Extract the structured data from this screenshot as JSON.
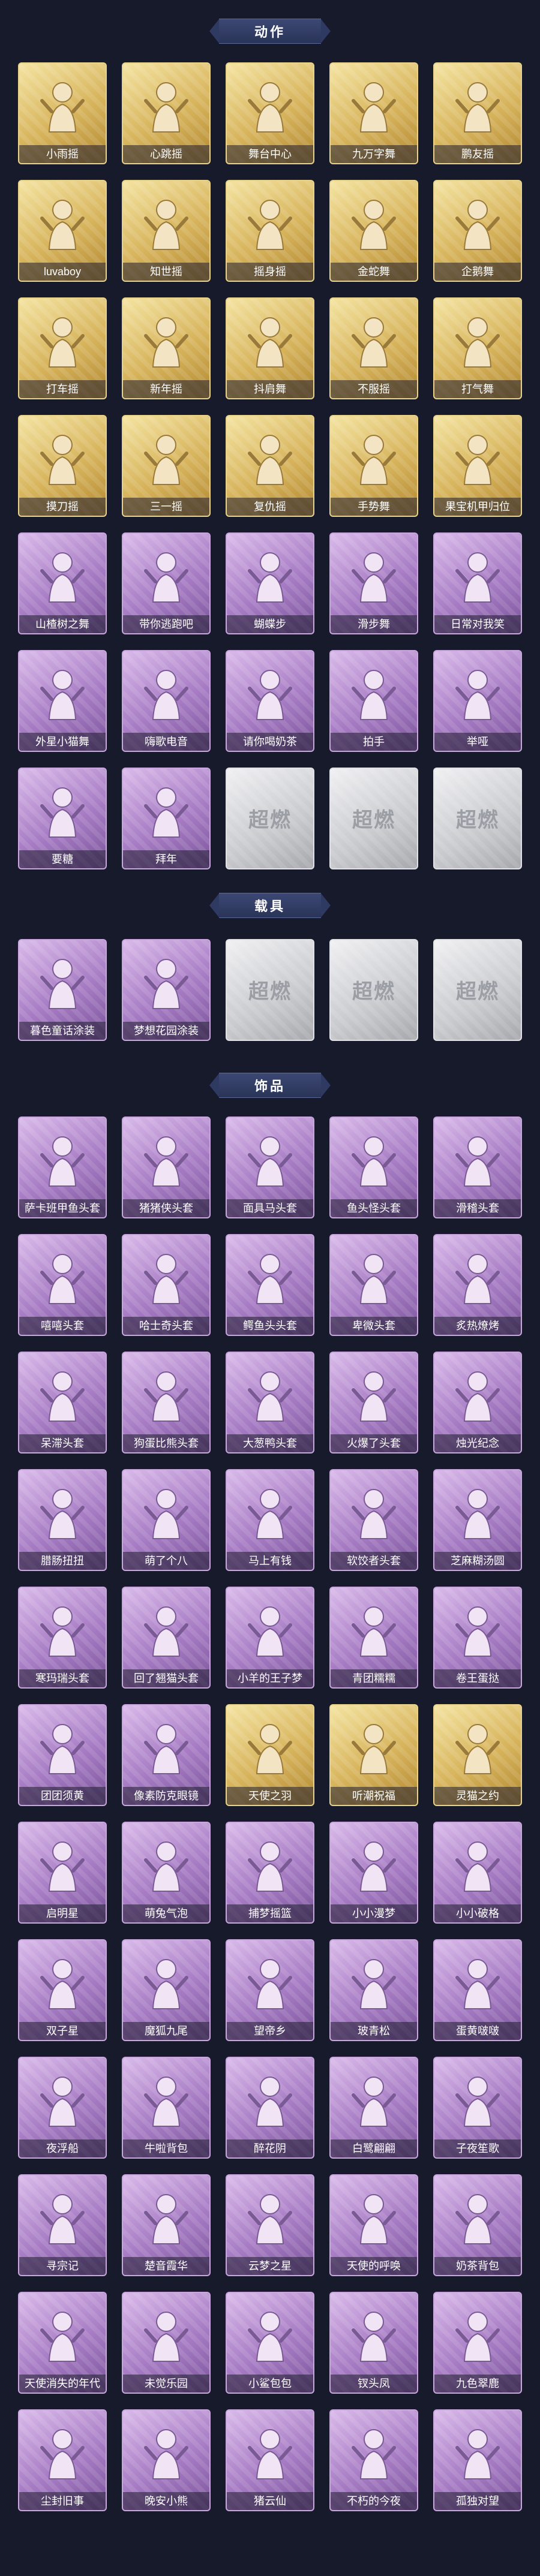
{
  "sections": [
    {
      "id": "actions",
      "title": "动作",
      "items": [
        {
          "label": "小雨摇",
          "tier": "gold",
          "icon": "pose-figure-icon"
        },
        {
          "label": "心跳摇",
          "tier": "gold",
          "icon": "pose-figure-icon"
        },
        {
          "label": "舞台中心",
          "tier": "gold",
          "icon": "pose-figure-icon"
        },
        {
          "label": "九万字舞",
          "tier": "gold",
          "icon": "pose-figure-icon"
        },
        {
          "label": "鹏友摇",
          "tier": "gold",
          "icon": "pose-figure-icon"
        },
        {
          "label": "luvaboy",
          "tier": "gold",
          "icon": "pose-figure-icon"
        },
        {
          "label": "知世摇",
          "tier": "gold",
          "icon": "pose-figure-icon"
        },
        {
          "label": "摇身摇",
          "tier": "gold",
          "icon": "pose-figure-icon"
        },
        {
          "label": "金蛇舞",
          "tier": "gold",
          "icon": "pose-figure-icon"
        },
        {
          "label": "企鹅舞",
          "tier": "gold",
          "icon": "pose-figure-icon"
        },
        {
          "label": "打车摇",
          "tier": "gold",
          "icon": "pose-figure-icon"
        },
        {
          "label": "新年摇",
          "tier": "gold",
          "icon": "pose-figure-icon"
        },
        {
          "label": "抖肩舞",
          "tier": "gold",
          "icon": "pose-figure-icon"
        },
        {
          "label": "不服摇",
          "tier": "gold",
          "icon": "pose-figure-icon"
        },
        {
          "label": "打气舞",
          "tier": "gold",
          "icon": "pose-figure-icon"
        },
        {
          "label": "摸刀摇",
          "tier": "gold",
          "icon": "pose-figure-icon"
        },
        {
          "label": "三一摇",
          "tier": "gold",
          "icon": "pose-figure-icon"
        },
        {
          "label": "复仇摇",
          "tier": "gold",
          "icon": "pose-figure-icon"
        },
        {
          "label": "手势舞",
          "tier": "gold",
          "icon": "pose-figure-icon"
        },
        {
          "label": "果宝机甲归位",
          "tier": "gold",
          "icon": "pose-figure-icon"
        },
        {
          "label": "山楂树之舞",
          "tier": "purple",
          "icon": "pose-figure-icon"
        },
        {
          "label": "带你逃跑吧",
          "tier": "purple",
          "icon": "pose-figure-icon"
        },
        {
          "label": "蝴蝶步",
          "tier": "purple",
          "icon": "pose-figure-icon"
        },
        {
          "label": "滑步舞",
          "tier": "purple",
          "icon": "pose-figure-icon"
        },
        {
          "label": "日常对我笑",
          "tier": "purple",
          "icon": "pose-figure-icon"
        },
        {
          "label": "外星小猫舞",
          "tier": "purple",
          "icon": "pose-figure-icon"
        },
        {
          "label": "嗨歌电音",
          "tier": "purple",
          "icon": "pose-figure-icon"
        },
        {
          "label": "请你喝奶茶",
          "tier": "purple",
          "icon": "pose-figure-icon"
        },
        {
          "label": "拍手",
          "tier": "purple",
          "icon": "pose-figure-icon"
        },
        {
          "label": "举哑",
          "tier": "purple",
          "icon": "pose-figure-icon"
        },
        {
          "label": "要糖",
          "tier": "purple",
          "icon": "pose-figure-icon"
        },
        {
          "label": "拜年",
          "tier": "purple",
          "icon": "pose-figure-icon"
        },
        {
          "label": "",
          "tier": "silver",
          "icon": "locked-placeholder-icon"
        },
        {
          "label": "",
          "tier": "silver",
          "icon": "locked-placeholder-icon"
        },
        {
          "label": "",
          "tier": "silver",
          "icon": "locked-placeholder-icon"
        }
      ]
    },
    {
      "id": "vehicles",
      "title": "载具",
      "items": [
        {
          "label": "暮色童话涂装",
          "tier": "purple",
          "icon": "castle-vehicle-icon"
        },
        {
          "label": "梦想花园涂装",
          "tier": "purple",
          "icon": "truck-vehicle-icon"
        },
        {
          "label": "",
          "tier": "silver",
          "icon": "locked-placeholder-icon"
        },
        {
          "label": "",
          "tier": "silver",
          "icon": "locked-placeholder-icon"
        },
        {
          "label": "",
          "tier": "silver",
          "icon": "locked-placeholder-icon"
        }
      ]
    },
    {
      "id": "accessories",
      "title": "饰品",
      "items": [
        {
          "label": "萨卡班甲鱼头套",
          "tier": "purple",
          "icon": "fish-head-icon"
        },
        {
          "label": "猪猪侠头套",
          "tier": "purple",
          "icon": "panda-head-icon"
        },
        {
          "label": "面具马头套",
          "tier": "purple",
          "icon": "horse-head-icon"
        },
        {
          "label": "鱼头怪头套",
          "tier": "purple",
          "icon": "green-fish-head-icon"
        },
        {
          "label": "滑稽头套",
          "tier": "purple",
          "icon": "smiley-head-icon"
        },
        {
          "label": "嘻嘻头套",
          "tier": "purple",
          "icon": "grin-head-icon"
        },
        {
          "label": "哈士奇头套",
          "tier": "purple",
          "icon": "dog-head-icon"
        },
        {
          "label": "鳄鱼头头套",
          "tier": "purple",
          "icon": "crocodile-head-icon"
        },
        {
          "label": "卑微头套",
          "tier": "purple",
          "icon": "sad-face-icon"
        },
        {
          "label": "炙热燎烤",
          "tier": "purple",
          "icon": "bbq-icon"
        },
        {
          "label": "呆滞头套",
          "tier": "purple",
          "icon": "blank-face-icon"
        },
        {
          "label": "狗蛋比熊头套",
          "tier": "purple",
          "icon": "yellow-dog-head-icon"
        },
        {
          "label": "大葱鸭头套",
          "tier": "purple",
          "icon": "onion-duck-icon"
        },
        {
          "label": "火爆了头套",
          "tier": "purple",
          "icon": "fire-head-icon"
        },
        {
          "label": "烛光纪念",
          "tier": "purple",
          "icon": "candle-icon"
        },
        {
          "label": "腊肠扭扭",
          "tier": "purple",
          "icon": "sausage-dog-icon"
        },
        {
          "label": "萌了个八",
          "tier": "purple",
          "icon": "radish-icon"
        },
        {
          "label": "马上有钱",
          "tier": "purple",
          "icon": "pink-horse-icon"
        },
        {
          "label": "软饺者头套",
          "tier": "purple",
          "icon": "dumpling-icon"
        },
        {
          "label": "芝麻糊汤圆",
          "tier": "purple",
          "icon": "rice-ball-icon"
        },
        {
          "label": "寒玛瑞头套",
          "tier": "purple",
          "icon": "black-cat-icon"
        },
        {
          "label": "回了翘猫头套",
          "tier": "purple",
          "icon": "blue-bird-icon"
        },
        {
          "label": "小羊的王子梦",
          "tier": "purple",
          "icon": "sheep-prince-icon"
        },
        {
          "label": "青团糯糯",
          "tier": "purple",
          "icon": "green-ball-icon"
        },
        {
          "label": "卷王蛋挞",
          "tier": "purple",
          "icon": "egg-tart-icon"
        },
        {
          "label": "团团须黄",
          "tier": "purple",
          "icon": "yellow-creature-icon"
        },
        {
          "label": "像素防克眼镜",
          "tier": "purple",
          "icon": "pixel-sunglasses-icon"
        },
        {
          "label": "天使之羽",
          "tier": "gold",
          "icon": "angel-wings-icon"
        },
        {
          "label": "听潮祝福",
          "tier": "gold",
          "icon": "blessing-figure-icon"
        },
        {
          "label": "灵猫之约",
          "tier": "gold",
          "icon": "cat-figure-icon"
        },
        {
          "label": "启明星",
          "tier": "purple",
          "icon": "star-figure-icon"
        },
        {
          "label": "萌兔气泡",
          "tier": "purple",
          "icon": "bunny-bubble-icon"
        },
        {
          "label": "捕梦摇篮",
          "tier": "purple",
          "icon": "dream-catcher-icon"
        },
        {
          "label": "小小漫梦",
          "tier": "purple",
          "icon": "yellow-doll-icon"
        },
        {
          "label": "小小破格",
          "tier": "purple",
          "icon": "pink-doll-icon"
        },
        {
          "label": "双子星",
          "tier": "purple",
          "icon": "twin-doll-icon"
        },
        {
          "label": "魔狐九尾",
          "tier": "purple",
          "icon": "nine-tail-fox-icon"
        },
        {
          "label": "望帝乡",
          "tier": "purple",
          "icon": "ancient-figure-icon"
        },
        {
          "label": "玻青松",
          "tier": "purple",
          "icon": "pine-tree-icon"
        },
        {
          "label": "蛋黄啵啵",
          "tier": "purple",
          "icon": "yolk-doll-icon"
        },
        {
          "label": "夜浮船",
          "tier": "purple",
          "icon": "snowflake-icon"
        },
        {
          "label": "牛啦背包",
          "tier": "purple",
          "icon": "cow-backpack-icon"
        },
        {
          "label": "醉花阴",
          "tier": "purple",
          "icon": "flower-figure-icon"
        },
        {
          "label": "白鹭翩翩",
          "tier": "purple",
          "icon": "egret-icon"
        },
        {
          "label": "子夜笙歌",
          "tier": "purple",
          "icon": "dark-figure-icon"
        },
        {
          "label": "寻宗记",
          "tier": "purple",
          "icon": "tiger-doll-icon"
        },
        {
          "label": "楚音霞华",
          "tier": "purple",
          "icon": "lady-figure-icon"
        },
        {
          "label": "云梦之星",
          "tier": "purple",
          "icon": "unicorn-icon"
        },
        {
          "label": "天使的呼唤",
          "tier": "purple",
          "icon": "angel-figure-icon"
        },
        {
          "label": "奶茶背包",
          "tier": "purple",
          "icon": "milk-tea-bag-icon"
        },
        {
          "label": "天使消失的年代",
          "tier": "purple",
          "icon": "winged-figure-icon"
        },
        {
          "label": "未觉乐园",
          "tier": "purple",
          "icon": "dream-park-icon"
        },
        {
          "label": "小鲨包包",
          "tier": "purple",
          "icon": "shark-bag-icon"
        },
        {
          "label": "钗头凤",
          "tier": "purple",
          "icon": "phoenix-figure-icon"
        },
        {
          "label": "九色翠鹿",
          "tier": "purple",
          "icon": "deer-icon"
        },
        {
          "label": "尘封旧事",
          "tier": "purple",
          "icon": "doll-keychain-icon"
        },
        {
          "label": "晚安小熊",
          "tier": "purple",
          "icon": "bear-keychain-icon"
        },
        {
          "label": "猪云仙",
          "tier": "purple",
          "icon": "pig-cloud-icon"
        },
        {
          "label": "不朽的今夜",
          "tier": "purple",
          "icon": "pink-pendant-icon"
        },
        {
          "label": "孤独对望",
          "tier": "purple",
          "icon": "mirror-figure-icon"
        }
      ]
    }
  ],
  "placeholder_logo": "超燃",
  "colors": {
    "background": "#161a2b",
    "gold": "#d7b45c",
    "purple": "#a77cc4",
    "silver": "#c9cace"
  }
}
